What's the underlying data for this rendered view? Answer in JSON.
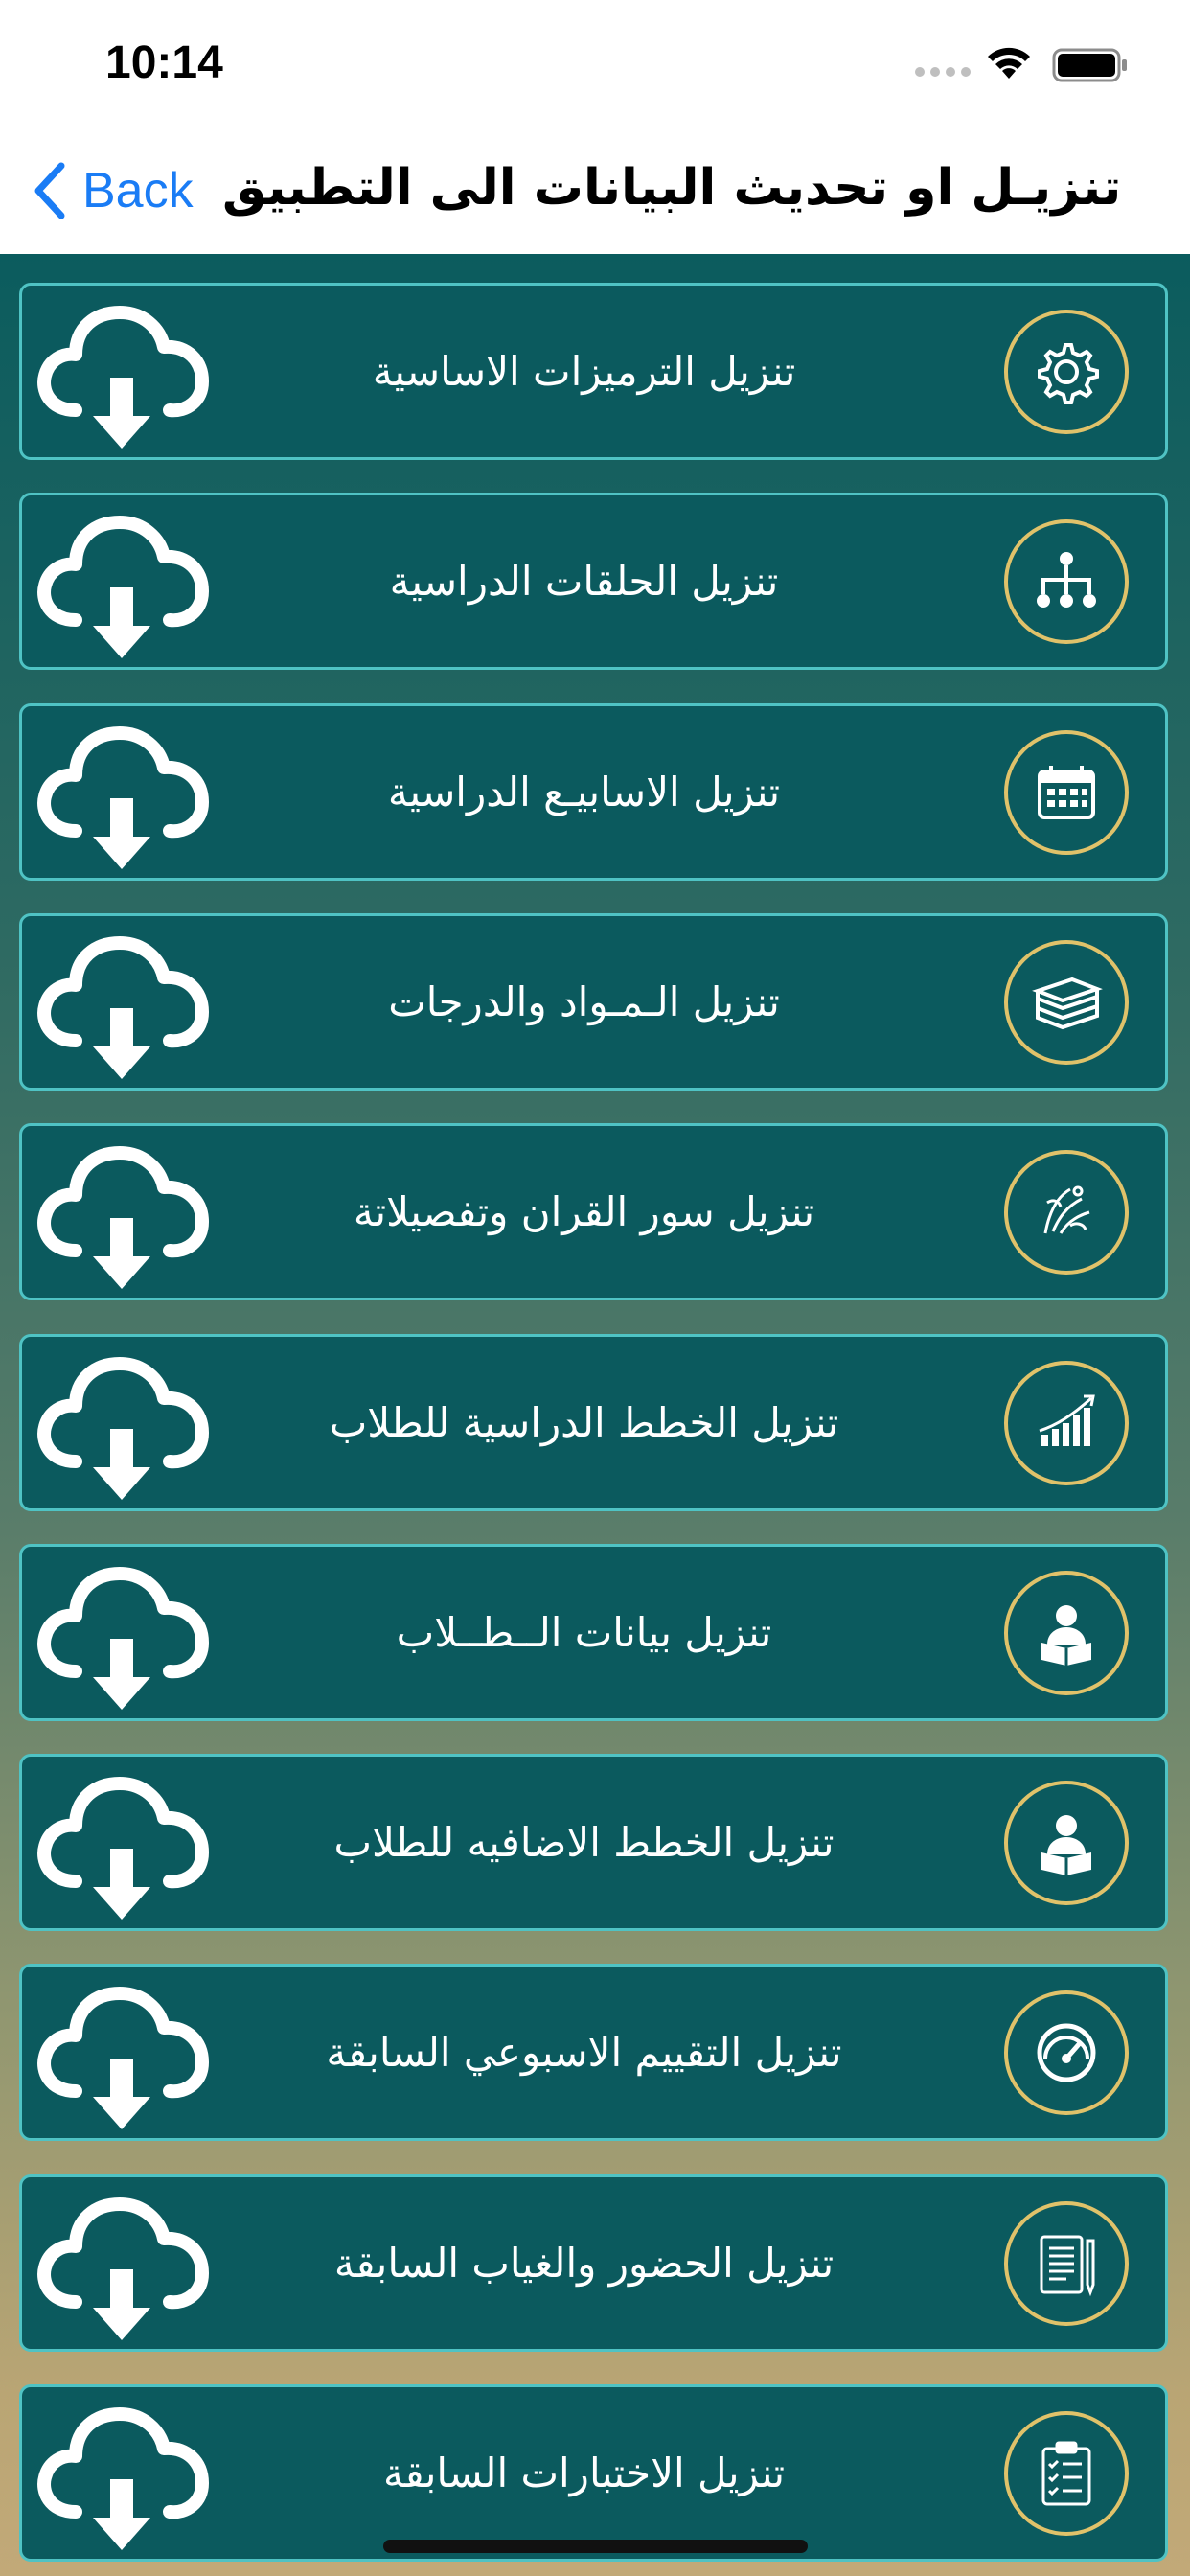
{
  "status_bar": {
    "time": "10:14"
  },
  "nav": {
    "back_label": "Back",
    "title": "تنزيـل او تحديث البيانات الى التطبيق"
  },
  "colors": {
    "accent": "#1a7cf5",
    "row_bg": "#0b5a5e",
    "row_border": "#4fc3c4",
    "badge_ring": "#e0c26a"
  },
  "rows": [
    {
      "label": "تنزيل الترميزات الاساسية",
      "icon": "gear-icon"
    },
    {
      "label": "تنزيل الحلقات الدراسية",
      "icon": "hierarchy-icon"
    },
    {
      "label": "تنزيل الاسابيـع الدراسية",
      "icon": "calendar-icon"
    },
    {
      "label": "تنزيل الـمـواد والدرجات",
      "icon": "books-icon"
    },
    {
      "label": "تنزيل سور القران وتفصيلاتة",
      "icon": "quran-icon"
    },
    {
      "label": "تنزيل الخطط الدراسية للطلاب",
      "icon": "growth-chart-icon"
    },
    {
      "label": "تنزيل بيانات الــطــلاب",
      "icon": "student-reading-icon"
    },
    {
      "label": "تنزيل  الخطط الاضافيه للطلاب",
      "icon": "student-reading-icon"
    },
    {
      "label": "تنزيل التقييم الاسبوعي السابقة",
      "icon": "gauge-icon"
    },
    {
      "label": "تنزيل الحضور والغياب السابقة",
      "icon": "report-pen-icon"
    },
    {
      "label": "تنزيل  الاختبارات السابقة",
      "icon": "checklist-icon"
    }
  ]
}
